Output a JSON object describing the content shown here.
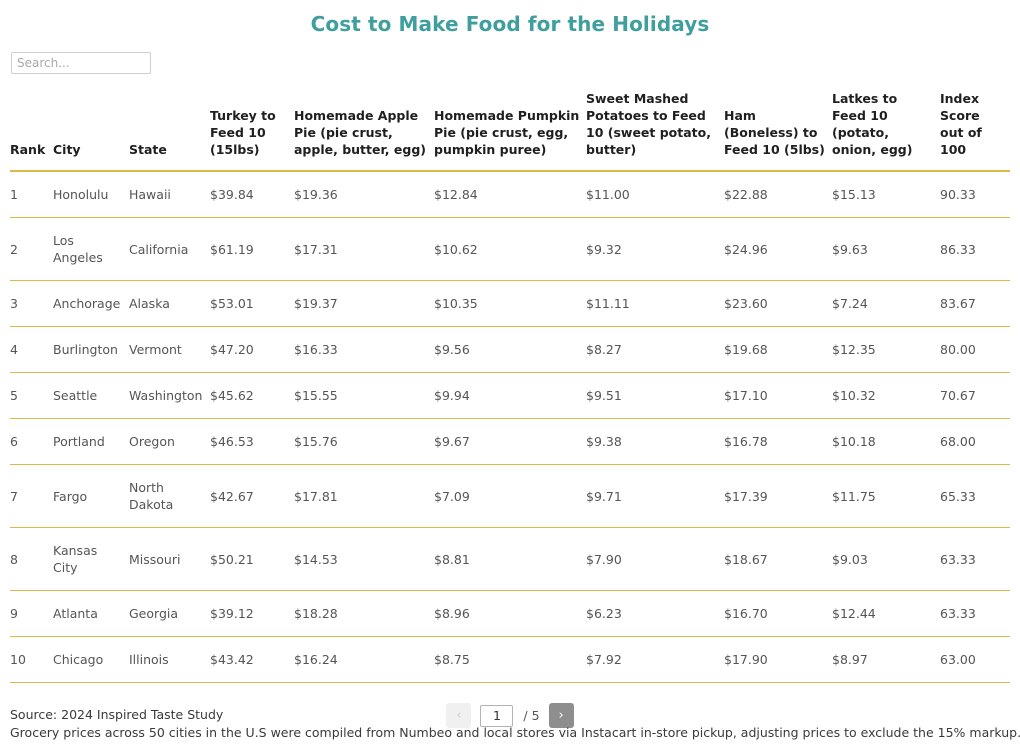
{
  "header": {
    "title": "Cost to Make Food for the Holidays",
    "title_color": "#3f9e9e"
  },
  "search": {
    "placeholder": "Search...",
    "value": ""
  },
  "table": {
    "columns": [
      "Rank",
      "City",
      "State",
      "Turkey to Feed 10 (15lbs)",
      "Homemade Apple Pie (pie crust, apple, butter, egg)",
      "Homemade Pumpkin Pie (pie crust, egg, pumpkin puree)",
      "Sweet Mashed Potatoes to Feed 10 (sweet potato, butter)",
      "Ham (Boneless) to Feed 10 (5lbs)",
      "Latkes to Feed 10 (potato, onion, egg)",
      "Index Score out of 100"
    ],
    "rows": [
      [
        "1",
        "Honolulu",
        "Hawaii",
        "$39.84",
        "$19.36",
        "$12.84",
        "$11.00",
        "$22.88",
        "$15.13",
        "90.33"
      ],
      [
        "2",
        "Los Angeles",
        "California",
        "$61.19",
        "$17.31",
        "$10.62",
        "$9.32",
        "$24.96",
        "$9.63",
        "86.33"
      ],
      [
        "3",
        "Anchorage",
        "Alaska",
        "$53.01",
        "$19.37",
        "$10.35",
        "$11.11",
        "$23.60",
        "$7.24",
        "83.67"
      ],
      [
        "4",
        "Burlington",
        "Vermont",
        "$47.20",
        "$16.33",
        "$9.56",
        "$8.27",
        "$19.68",
        "$12.35",
        "80.00"
      ],
      [
        "5",
        "Seattle",
        "Washington",
        "$45.62",
        "$15.55",
        "$9.94",
        "$9.51",
        "$17.10",
        "$10.32",
        "70.67"
      ],
      [
        "6",
        "Portland",
        "Oregon",
        "$46.53",
        "$15.76",
        "$9.67",
        "$9.38",
        "$16.78",
        "$10.18",
        "68.00"
      ],
      [
        "7",
        "Fargo",
        "North Dakota",
        "$42.67",
        "$17.81",
        "$7.09",
        "$9.71",
        "$17.39",
        "$11.75",
        "65.33"
      ],
      [
        "8",
        "Kansas City",
        "Missouri",
        "$50.21",
        "$14.53",
        "$8.81",
        "$7.90",
        "$18.67",
        "$9.03",
        "63.33"
      ],
      [
        "9",
        "Atlanta",
        "Georgia",
        "$39.12",
        "$18.28",
        "$8.96",
        "$6.23",
        "$16.70",
        "$12.44",
        "63.33"
      ],
      [
        "10",
        "Chicago",
        "Illinois",
        "$43.42",
        "$16.24",
        "$8.75",
        "$7.92",
        "$17.90",
        "$8.97",
        "63.00"
      ]
    ],
    "row_border_color": "#ddb949"
  },
  "pagination": {
    "prev_label": "‹",
    "next_label": "›",
    "current_page": "1",
    "total_pages_label": "/ 5"
  },
  "footer": {
    "line1": "Source: 2024 Inspired Taste Study",
    "line2": "Grocery prices across 50 cities in the U.S were compiled from Numbeo and local stores via Instacart in-store pickup, adjusting prices to exclude the 15% markup."
  }
}
